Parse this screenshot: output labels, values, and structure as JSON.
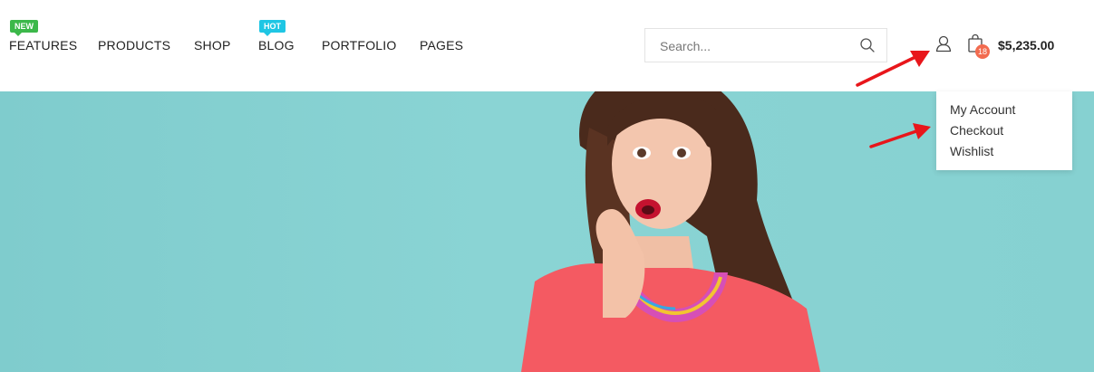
{
  "nav": {
    "items": [
      {
        "label": "FEATURES"
      },
      {
        "label": "PRODUCTS"
      },
      {
        "label": "SHOP"
      },
      {
        "label": "BLOG"
      },
      {
        "label": "PORTFOLIO"
      },
      {
        "label": "PAGES"
      }
    ],
    "badges": {
      "features": {
        "text": "NEW",
        "color": "#3cb84a"
      },
      "blog": {
        "text": "HOT",
        "color": "#1fc6e4"
      }
    }
  },
  "search": {
    "placeholder": "Search..."
  },
  "cart": {
    "count": "18",
    "total": "$5,235.00",
    "count_color": "#f26b4f"
  },
  "account_menu": {
    "items": [
      {
        "label": "My Account"
      },
      {
        "label": "Checkout"
      },
      {
        "label": "Wishlist"
      }
    ]
  },
  "colors": {
    "hero_bg": "#86d1d1",
    "arrow": "#e8161b"
  },
  "icons": [
    "search-icon",
    "user-icon",
    "cart-icon",
    "arrow-icon"
  ]
}
